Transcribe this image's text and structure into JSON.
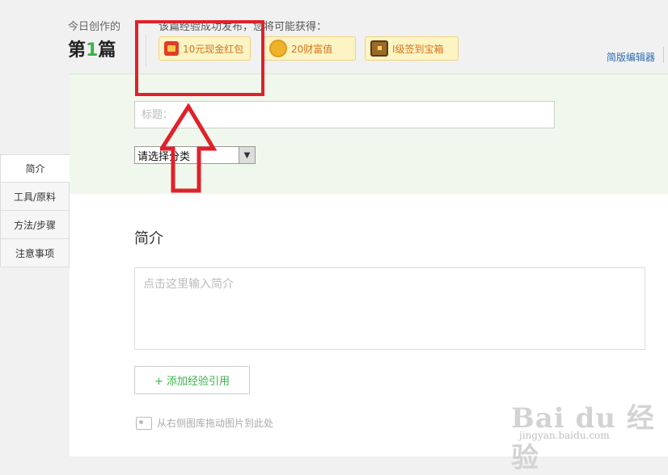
{
  "header": {
    "today_label": "今日创作的",
    "count_prefix": "第",
    "count_number": "1",
    "count_suffix": "篇",
    "reward_lead": "该篇经验成功发布，您将可能获得：",
    "rewards": [
      {
        "label": "10元现金红包",
        "icon": "red-envelope-icon"
      },
      {
        "label": "20财富值",
        "icon": "coin-icon"
      },
      {
        "label": "I级签到宝箱",
        "icon": "treasure-chest-icon"
      }
    ],
    "simple_editor": "简版编辑器"
  },
  "form": {
    "title_placeholder": "标题：",
    "category_value": "请选择分类"
  },
  "sidebar": {
    "items": [
      {
        "label": "简介"
      },
      {
        "label": "工具/原料"
      },
      {
        "label": "方法/步骤"
      },
      {
        "label": "注意事项"
      }
    ]
  },
  "intro": {
    "heading": "简介",
    "placeholder": "点击这里输入简介",
    "add_ref_button": "+ 添加经验引用",
    "drag_tip": "从右侧图库拖动图片到此处"
  },
  "watermark": {
    "brand": "Bai du 经验",
    "domain": "jingyan.baidu.com"
  },
  "colors": {
    "accent_green": "#3bb34a",
    "annotation_red": "#e0212b",
    "reward_bg": "#fdf4c4",
    "panel_green": "#f0f8ed"
  }
}
